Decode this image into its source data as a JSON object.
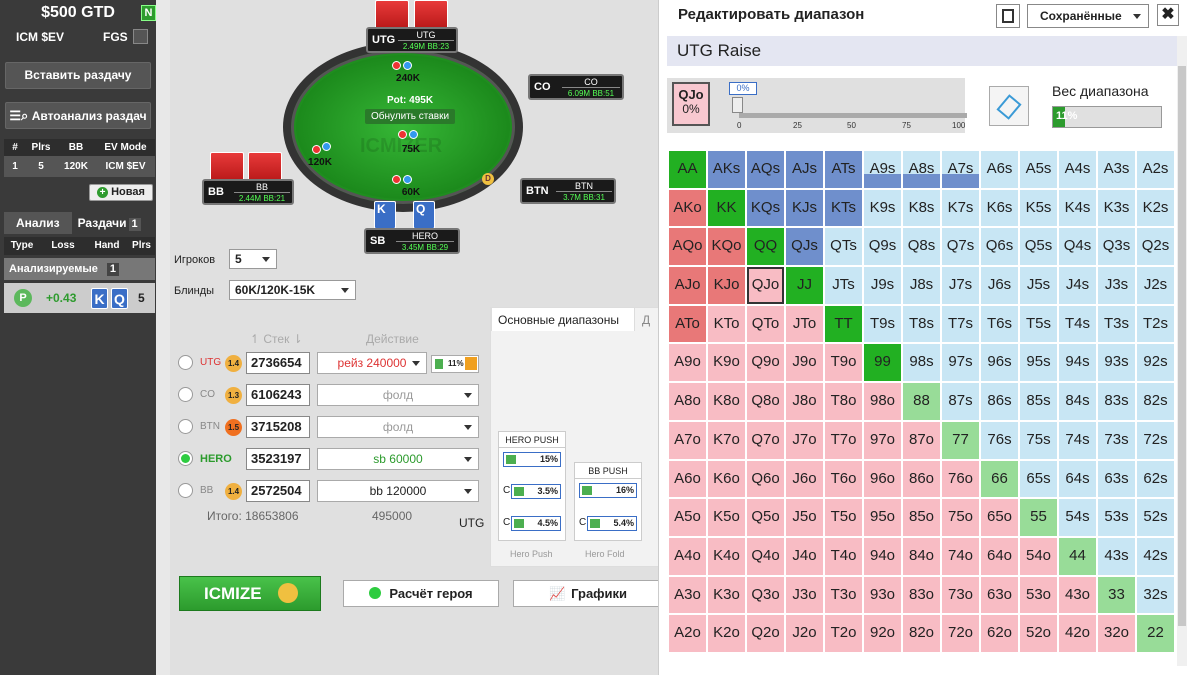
{
  "sidebar": {
    "title": "$500 GTD",
    "n_badge": "N",
    "icm_label": "ICM $EV",
    "fgs_label": "FGS",
    "insert_button": "Вставить раздачу",
    "autoanalysis_button": "Автоанализ раздач",
    "table_headers": [
      "#",
      "Plrs",
      "BB",
      "EV Mode"
    ],
    "table_row": [
      "1",
      "5",
      "120K",
      "ICM $EV"
    ],
    "new_button": "Новая",
    "tab_analysis": "Анализ",
    "tab_hands": "Раздачи",
    "tab_hands_count": "1",
    "hand_headers": [
      "Type",
      "Loss",
      "Hand",
      "Plrs"
    ],
    "analyzed_label": "Анализируемые",
    "analyzed_count": "1",
    "item": {
      "badge": "P",
      "ev": "+0.43",
      "card1": "K",
      "card2": "Q",
      "players": "5"
    }
  },
  "table": {
    "pot": "Pot: 495K",
    "reset_bets": "Обнулить ставки",
    "watermark": "ICMIZER",
    "bets": {
      "utg": "240K",
      "bb": "120K",
      "sb": "75K",
      "hero": "60K"
    },
    "seats": [
      {
        "pos": "UTG",
        "name": "UTG",
        "stack": "2.49M",
        "bb": "BB:23"
      },
      {
        "pos": "CO",
        "name": "CO",
        "stack": "6.09M",
        "bb": "BB:51"
      },
      {
        "pos": "BTN",
        "name": "BTN",
        "stack": "3.7M",
        "bb": "BB:31"
      },
      {
        "pos": "SB",
        "name": "HERO",
        "stack": "3.45M",
        "bb": "BB:29"
      },
      {
        "pos": "BB",
        "name": "BB",
        "stack": "2.44M",
        "bb": "BB:21"
      }
    ],
    "hero_cards": [
      "K",
      "Q"
    ],
    "dealer": "D"
  },
  "settings": {
    "players_label": "Игроков",
    "players_value": "5",
    "blinds_label": "Блинды",
    "blinds_value": "60K/120K-15K",
    "stack_header": "Стек",
    "action_header": "Действие"
  },
  "players": [
    {
      "pos": "UTG",
      "icm": "1.4",
      "stack": "2736654",
      "action": "рейз 240000",
      "active": false
    },
    {
      "pos": "CO",
      "icm": "1.3",
      "stack": "6106243",
      "action": "фолд",
      "active": false
    },
    {
      "pos": "BTN",
      "icm": "1.5",
      "stack": "3715208",
      "action": "фолд",
      "active": false
    },
    {
      "pos": "HERO",
      "icm": "1.3",
      "stack": "3523197",
      "action": "sb 60000",
      "active": true
    },
    {
      "pos": "BB",
      "icm": "1.4",
      "stack": "2572504",
      "action": "bb 120000",
      "active": false
    }
  ],
  "utg_range_pct": "11%",
  "totals": {
    "stack": "Итого: 18653806",
    "action": "495000",
    "utg": "UTG"
  },
  "ranges_tab": "Основные диапазоны",
  "ranges_tab2": "Д",
  "hero_push": {
    "title": "HERO PUSH",
    "values": [
      "15%",
      "3.5%",
      "4.5%"
    ],
    "caption": "Hero Push"
  },
  "bb_push": {
    "title": "BB PUSH",
    "values": [
      "16%",
      "5.4%"
    ],
    "caption": "Hero Fold"
  },
  "c_label": "C",
  "buttons": {
    "icmize": "ICMIZE",
    "hero_calc": "Расчёт героя",
    "charts": "Графики"
  },
  "editor": {
    "title": "Редактировать диапазон",
    "saved": "Сохранённые",
    "close": "✖",
    "range_name": "UTG Raise",
    "hand": "QJo",
    "hand_pct": "0%",
    "slider_value": "0%",
    "slider_ticks": [
      "0",
      "25",
      "50",
      "75",
      "100"
    ],
    "weight_label": "Вес диапазона",
    "weight_value": "11%",
    "weight_fraction": 0.11
  },
  "grid": [
    [
      "AA",
      "AKs",
      "AQs",
      "AJs",
      "ATs",
      "A9s",
      "A8s",
      "A7s",
      "A6s",
      "A5s",
      "A4s",
      "A3s",
      "A2s"
    ],
    [
      "AKo",
      "KK",
      "KQs",
      "KJs",
      "KTs",
      "K9s",
      "K8s",
      "K7s",
      "K6s",
      "K5s",
      "K4s",
      "K3s",
      "K2s"
    ],
    [
      "AQo",
      "KQo",
      "QQ",
      "QJs",
      "QTs",
      "Q9s",
      "Q8s",
      "Q7s",
      "Q6s",
      "Q5s",
      "Q4s",
      "Q3s",
      "Q2s"
    ],
    [
      "AJo",
      "KJo",
      "QJo",
      "JJ",
      "JTs",
      "J9s",
      "J8s",
      "J7s",
      "J6s",
      "J5s",
      "J4s",
      "J3s",
      "J2s"
    ],
    [
      "ATo",
      "KTo",
      "QTo",
      "JTo",
      "TT",
      "T9s",
      "T8s",
      "T7s",
      "T6s",
      "T5s",
      "T4s",
      "T3s",
      "T2s"
    ],
    [
      "A9o",
      "K9o",
      "Q9o",
      "J9o",
      "T9o",
      "99",
      "98s",
      "97s",
      "96s",
      "95s",
      "94s",
      "93s",
      "92s"
    ],
    [
      "A8o",
      "K8o",
      "Q8o",
      "J8o",
      "T8o",
      "98o",
      "88",
      "87s",
      "86s",
      "85s",
      "84s",
      "83s",
      "82s"
    ],
    [
      "A7o",
      "K7o",
      "Q7o",
      "J7o",
      "T7o",
      "97o",
      "87o",
      "77",
      "76s",
      "75s",
      "74s",
      "73s",
      "72s"
    ],
    [
      "A6o",
      "K6o",
      "Q6o",
      "J6o",
      "T6o",
      "96o",
      "86o",
      "76o",
      "66",
      "65s",
      "64s",
      "63s",
      "62s"
    ],
    [
      "A5o",
      "K5o",
      "Q5o",
      "J5o",
      "T5o",
      "95o",
      "85o",
      "75o",
      "65o",
      "55",
      "54s",
      "53s",
      "52s"
    ],
    [
      "A4o",
      "K4o",
      "Q4o",
      "J4o",
      "T4o",
      "94o",
      "84o",
      "74o",
      "64o",
      "54o",
      "44",
      "43s",
      "42s"
    ],
    [
      "A3o",
      "K3o",
      "Q3o",
      "J3o",
      "T3o",
      "93o",
      "83o",
      "73o",
      "63o",
      "53o",
      "43o",
      "33",
      "32s"
    ],
    [
      "A2o",
      "K2o",
      "Q2o",
      "J2o",
      "T2o",
      "92o",
      "82o",
      "72o",
      "62o",
      "52o",
      "42o",
      "32o",
      "22"
    ]
  ],
  "raised_hands": [
    "AA",
    "AKs",
    "AQs",
    "AJs",
    "ATs",
    "AKo",
    "KK",
    "KQs",
    "KJs",
    "KTs",
    "AQo",
    "KQo",
    "QQ",
    "QJs",
    "AJo",
    "KJo",
    "JJ",
    "ATo",
    "TT",
    "99"
  ],
  "partial_hands": [
    "A9s",
    "A8s",
    "A7s"
  ],
  "selected_hand": "QJo"
}
